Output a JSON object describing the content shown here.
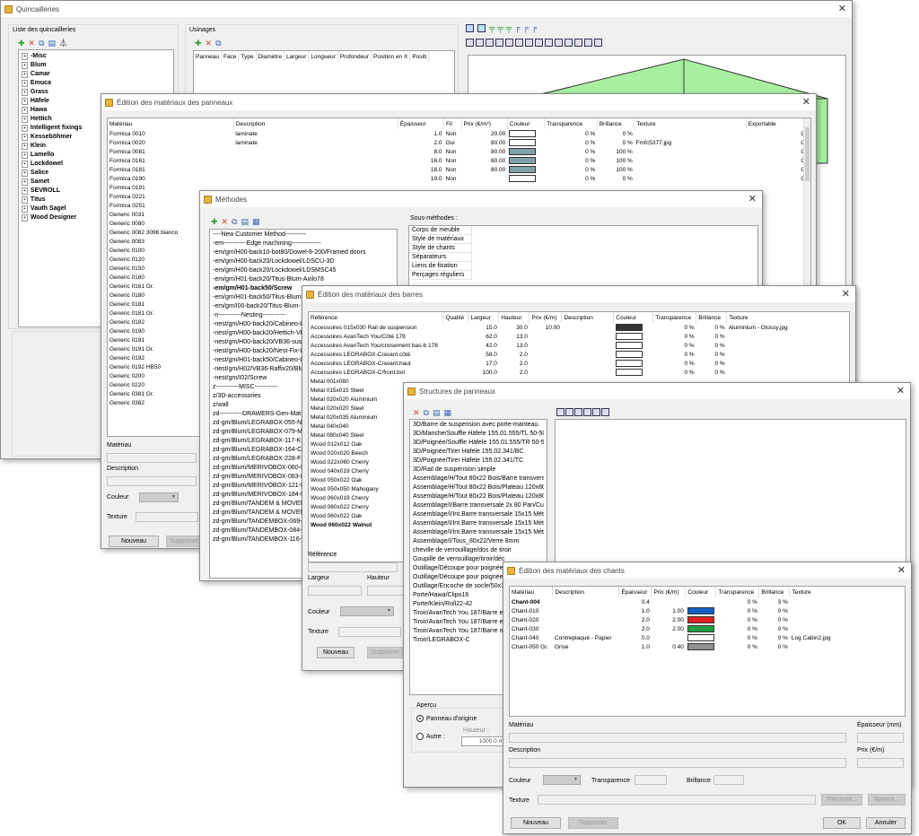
{
  "quincailleries": {
    "title": "Quincailleries",
    "list_label": "Liste des quincailleries",
    "usinages_label": "Usinages",
    "manufacturers": [
      "-Misc",
      "Blum",
      "Camar",
      "Emuca",
      "Grass",
      "Häfele",
      "Hawa",
      "Hettich",
      "Intelligent fixings",
      "Kesseböhmer",
      "Klein",
      "Lamello",
      "Lockdowel",
      "Salice",
      "Samet",
      "SEVROLL",
      "Titus",
      "Vauth Sagel",
      "Wood Designer"
    ],
    "usinage_columns": [
      "Panneau",
      "Face",
      "Type",
      "Diamètre",
      "Largeur",
      "Longueur",
      "Profondeur",
      "Position en X",
      "Positi"
    ]
  },
  "panneaux": {
    "title": "Édition des matériaux des panneaux",
    "columns": [
      "Matériau",
      "Description",
      "Épaisseur",
      "Fil",
      "Prix (€/m²)",
      "Couleur",
      "Transparence",
      "Brillance",
      "Texture",
      "Exportable"
    ],
    "rows": [
      {
        "mat": "Formica 0010",
        "desc": "laminate",
        "ep": "1.0",
        "fil": "Non",
        "prix": "20.00",
        "col": "#ffffff",
        "tr": "0 %",
        "br": "0 %",
        "tex": "",
        "exp": "Oui"
      },
      {
        "mat": "Formica 0020",
        "desc": "laminate",
        "ep": "2.0",
        "fil": "Oui",
        "prix": "80.00",
        "col": "#ffffff",
        "tr": "0 %",
        "br": "0 %",
        "tex": "Fmfc5377.jpg",
        "exp": "Oui"
      },
      {
        "mat": "Formica 0081",
        "desc": "",
        "ep": "8.0",
        "fil": "Non",
        "prix": "80.00",
        "col": "#7fa0a8",
        "tr": "0 %",
        "br": "100 %",
        "tex": "",
        "exp": "Oui"
      },
      {
        "mat": "Formica 0161",
        "desc": "",
        "ep": "16.0",
        "fil": "Non",
        "prix": "80.00",
        "col": "#7fa0a8",
        "tr": "0 %",
        "br": "100 %",
        "tex": "",
        "exp": "Oui"
      },
      {
        "mat": "Formica 0181",
        "desc": "",
        "ep": "18.0",
        "fil": "Non",
        "prix": "80.00",
        "col": "#7fa0a8",
        "tr": "0 %",
        "br": "100 %",
        "tex": "",
        "exp": "Oui"
      },
      {
        "mat": "Formica 0190",
        "desc": "",
        "ep": "19.0",
        "fil": "Non",
        "prix": "",
        "col": "#ffffff",
        "tr": "0 %",
        "br": "0 %",
        "tex": "",
        "exp": "Oui"
      }
    ],
    "more_materials": [
      "Formica 0191",
      "Formica 0221",
      "Formica 0251",
      "Generic 0031",
      "Generic 0080",
      "Generic 0082 3096 bianco",
      "Generic 0083",
      "Generic 0100",
      "Generic 0120",
      "Generic 0150",
      "Generic 0160",
      "Generic 0161 Gr.",
      "Generic 0180",
      "Generic 0181",
      "Generic 0181 Gr.",
      "Generic 0182",
      "Generic 0190",
      "Generic 0191",
      "Generic 0191 Gr.",
      "Generic 0192",
      "Generic 0192 HB50",
      "Generic 0200",
      "Generic 0220",
      "Generic 0381 Gr.",
      "Generic 0382"
    ],
    "f_materiau": "Matériau",
    "f_description": "Description",
    "f_couleur": "Couleur",
    "f_texture": "Texture",
    "b_nouveau": "Nouveau",
    "b_supprimer": "Supprimer"
  },
  "methodes": {
    "title": "Méthodes",
    "sub_label": "Sous-méthodes :",
    "items": [
      "----New Customer Method----------",
      "-em-----------Edge machining--------------",
      "-em/gm/H00-back10-bot80/Dowel-8-200/Framed doors",
      "-em/gm/H00-back20/Lockdowel/LDSCU-3D",
      "-em/gm/H00-back20/Lockdowel/LDSMSC45",
      "-em/gm/H01-back20/Titus-Blum-Axilo78",
      "-em/gm/H01-back50/Screw",
      "-em/gm/H01-back50/Titus-Blum-",
      "-em/gm/I00-back20/Titus-Blum-",
      "-n-----------Nesting-----------",
      "-nest/gm/H00-back20/Cabineo-L",
      "-nest/gm/H00-back20/Hettich-VB",
      "-nest/gm/H00-back20/VB36-susp",
      "-nest/gm/H00-back20/Nest-Fix-L",
      "-nest/gm/H01-back50/Cabineo-L",
      "-nest/gm/H02/VB36-Raffix20/Blum",
      "-nest/gm/I02/Screw",
      "z-----------MISC-----------",
      "z/3D-accessories",
      "z/wall",
      "zd-----------DRAWERS-Gen-Mat-",
      "zd-gm/Blum/LEGRABOX-055-N",
      "zd-gm/Blum/LEGRABOX-079-M",
      "zd-gm/Blum/LEGRABOX-117-K",
      "zd-gm/Blum/LEGRABOX-164-C",
      "zd-gm/Blum/LEGRABOX-228-F",
      "zd-gm/Blum/MERIVOBOX-060-N",
      "zd-gm/Blum/MERIVOBOX-083-M",
      "zd-gm/Blum/MERIVOBOX-121-K",
      "zd-gm/Blum/MERIVOBOX-184-E",
      "zd-gm/Blum/TANDEM & MOVENTO",
      "zd-gm/Blum/TANDEM & MOVENTO",
      "zd-gm/Blum/TANDEMBOX-069-N",
      "zd-gm/Blum/TANDEMBOX-084-M",
      "zd-gm/Blum/TANDEMBOX-116-K"
    ],
    "sub_items": [
      "Corps de meuble",
      "Style de matériaux",
      "Style de chants",
      "Séparateurs",
      "Liens de fixation",
      "Perçages réguliers"
    ]
  },
  "barres": {
    "title": "Édition des matériaux des barres",
    "columns": [
      "Référence",
      "Qualité",
      "Largeur",
      "Hauteur",
      "Prix (€/m)",
      "Description",
      "Couleur",
      "Transparence",
      "Brillance",
      "Texture"
    ],
    "rows": [
      {
        "ref": "Accessoires 015x030 Rail de suspension",
        "l": "15.0",
        "h": "30.0",
        "p": "10.00",
        "col": "#333333",
        "tr": "0 %",
        "br": "0 %",
        "tex": "Aluminium - Glossy.jpg"
      },
      {
        "ref": "Accessoires AvanTech You/Côté 178",
        "l": "62.0",
        "h": "13.0",
        "p": "",
        "col": "#ffffff",
        "tr": "0 %",
        "br": "0 %",
        "tex": ""
      },
      {
        "ref": "Accessoires AvanTech You/croisement bas-b 178",
        "l": "42.0",
        "h": "13.0",
        "p": "",
        "col": "#ffffff",
        "tr": "0 %",
        "br": "0 %",
        "tex": ""
      },
      {
        "ref": "Accessoires LEGRABOX-C/avant.côté",
        "l": "58.0",
        "h": "2.0",
        "p": "",
        "col": "#ffffff",
        "tr": "0 %",
        "br": "0 %",
        "tex": ""
      },
      {
        "ref": "Accessoires LEGRABOX-C/avant.haut",
        "l": "17.0",
        "h": "2.0",
        "p": "",
        "col": "#ffffff",
        "tr": "0 %",
        "br": "0 %",
        "tex": ""
      },
      {
        "ref": "Accessoires LEGRABOX-C/front.bot",
        "l": "100.0",
        "h": "2.0",
        "p": "",
        "col": "#ffffff",
        "tr": "0 %",
        "br": "0 %",
        "tex": ""
      }
    ],
    "more_refs": [
      "Metal 001x080",
      "Metal 015x015 Steel",
      "Metal 020x020 Aluminium",
      "Metal 020x020 Steel",
      "Metal 020x035 Aluminium",
      "Metal 040x040",
      "Metal 080x040 Steel",
      "Wood 012x012 Oak",
      "Wood 020x020 Beech",
      "Wood 022x060 Cherry",
      "Wood 040x019 Cherry",
      "Wood 050x022 Oak",
      "Wood 050x050 Mahogany",
      "Wood 060x019 Cherry",
      "Wood 060x022 Cherry",
      "Wood 060x022 Oak",
      "Wood 060x022 Walnut"
    ],
    "f_reference": "Référence",
    "f_largeur": "Largeur",
    "f_hauteur": "Hauteur",
    "f_couleur": "Couleur",
    "f_texture": "Texture",
    "b_nouveau": "Nouveau",
    "b_supprimer": "Supprimer"
  },
  "structures": {
    "title": "Structures de panneaux",
    "items": [
      "3D/Barre de suspension avec porte-manteau.",
      "3D/Manche/Souffle Häfele 155.01.555/TL 50-50",
      "3D/Poignée/Souffle Häfele 155.01.555/TR 50-50",
      "3D/Poignée/Tirer Häfele 155.02.341/BC",
      "3D/Poignée/Tirer Häfele 155.02.341/TC",
      "3D/Rail de suspension simple",
      "Assemblage/H/Tout 80x22 Bois/Barre transversale",
      "Assemblage/H/Tout 80x22 Bois/Plateau 120x80",
      "Assemblage/H/Tout 80x22 Bois/Plateau 120x80",
      "Assemblage/I/Barre transversale 2x 80 Pan/Cuisine",
      "Assemblage/I/Int.Barre transversale 15x15 Métal",
      "Assemblage/I/Int.Barre transversale 15x15 Métal",
      "Assemblage/I/Int.Barre transversale 15x15 Métal",
      "Assemblage/I/Tous_80x22/Verre 8mm",
      "cheville de verrouillage/dos de tiroir",
      "Goupille de verrouillage/tiroir/déc",
      "Outillage/Découpe pour poignée",
      "Outillage/Découpe pour poignée",
      "Outillage/Encoche de socle/50x1",
      "Porte/Hawa/Clipo16",
      "Porte/Klein/Roll22-42",
      "Tiroir/AvanTech You 187/Barre en",
      "Tiroir/AvanTech You 187/Barre en",
      "Tiroir/AvanTech You 187/Barre m",
      "Tiroir/LEGRABOX-C"
    ],
    "apercu": "Aperçu",
    "radio1": "Panneau d'origine",
    "radio2": "Autre :",
    "hauteur": "Hauteur :",
    "hauteur_val": "1000.0 m"
  },
  "chants": {
    "title": "Édition des matériaux des chants",
    "columns": [
      "Matériau",
      "Description",
      "Épaisseur",
      "Prix (€/m)",
      "Couleur",
      "Transparence",
      "Brillance",
      "Texture"
    ],
    "rows": [
      {
        "mat": "Chant-004",
        "desc": "",
        "ep": "0.4",
        "p": "",
        "col": "",
        "tr": "0 %",
        "br": "3 %",
        "tex": "",
        "bold": true
      },
      {
        "mat": "Chant-010",
        "desc": "",
        "ep": "1.0",
        "p": "1.00",
        "col": "#1060c0",
        "tr": "0 %",
        "br": "0 %",
        "tex": ""
      },
      {
        "mat": "Chant-020",
        "desc": "",
        "ep": "2.0",
        "p": "2.00",
        "col": "#e02020",
        "tr": "0 %",
        "br": "0 %",
        "tex": ""
      },
      {
        "mat": "Chant-030",
        "desc": "",
        "ep": "2.0",
        "p": "2.00",
        "col": "#20a040",
        "tr": "0 %",
        "br": "0 %",
        "tex": ""
      },
      {
        "mat": "Chant-040",
        "desc": "Contreplaqué - Papier",
        "ep": "0.0",
        "p": "",
        "col": "#ffffff",
        "tr": "0 %",
        "br": "0 %",
        "tex": "Log Cabin2.jpg"
      },
      {
        "mat": "Chant-050 Gr.",
        "desc": "Grise",
        "ep": "1.0",
        "p": "0.40",
        "col": "#909090",
        "tr": "0 %",
        "br": "0 %",
        "tex": ""
      }
    ],
    "f_materiau": "Matériau",
    "f_epaisseur": "Épaisseur (mm)",
    "f_description": "Description",
    "f_prix": "Prix (€/m)",
    "f_couleur": "Couleur",
    "f_transparence": "Transparence",
    "f_brillance": "Brillance",
    "f_texture": "Texture",
    "b_parcourir": "Parcourir...",
    "b_avance": "Avancé...",
    "b_nouveau": "Nouveau",
    "b_supprimer": "Supprimer",
    "b_ok": "OK",
    "b_annuler": "Annuler"
  }
}
